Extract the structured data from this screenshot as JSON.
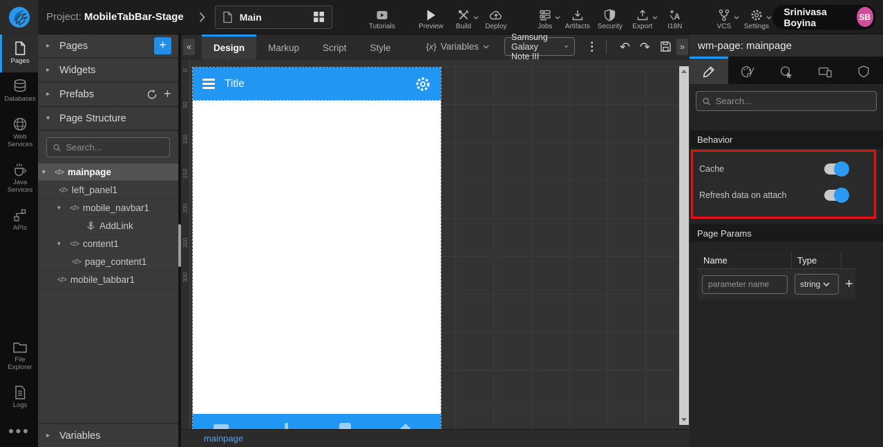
{
  "colors": {
    "accent": "#2196f3",
    "highlight": "#e90f0f",
    "avatar": "#cf4d9b"
  },
  "topbar": {
    "project_label": "Project:",
    "project_name": "MobileTabBar-Stage",
    "page_name": "Main",
    "tools": [
      {
        "label": "Tutorials"
      },
      {
        "label": "Preview"
      },
      {
        "label": "Build"
      },
      {
        "label": "Deploy"
      },
      {
        "label": "Jobs"
      },
      {
        "label": "Artifacts"
      },
      {
        "label": "Security"
      },
      {
        "label": "Export"
      },
      {
        "label": "I18N"
      },
      {
        "label": "VCS"
      },
      {
        "label": "Settings"
      }
    ],
    "user": {
      "name": "Srinivasa Boyina",
      "initials": "SB"
    }
  },
  "sidebar": {
    "items": [
      {
        "label": "Pages",
        "active": true
      },
      {
        "label": "Databases"
      },
      {
        "label": "Web Services"
      },
      {
        "label": "Java Services"
      },
      {
        "label": "APIs"
      }
    ],
    "bottom": [
      {
        "label": "File Explorer"
      },
      {
        "label": "Logs"
      }
    ]
  },
  "left_panel": {
    "sections": {
      "pages": "Pages",
      "widgets": "Widgets",
      "prefabs": "Prefabs",
      "page_structure": "Page Structure",
      "variables": "Variables"
    },
    "search_placeholder": "Search...",
    "tree": [
      {
        "label": "mainpage",
        "selected": true,
        "expanded": true
      },
      {
        "label": "left_panel1"
      },
      {
        "label": "mobile_navbar1",
        "expanded": true
      },
      {
        "label": "AddLink"
      },
      {
        "label": "content1",
        "expanded": true
      },
      {
        "label": "page_content1"
      },
      {
        "label": "mobile_tabbar1"
      }
    ]
  },
  "canvas": {
    "tabs": [
      {
        "label": "Design",
        "active": true
      },
      {
        "label": "Markup"
      },
      {
        "label": "Script"
      },
      {
        "label": "Style"
      }
    ],
    "variables_button": "Variables",
    "device": "Samsung Galaxy Note III",
    "ruler": [
      "0",
      "50",
      "100",
      "150",
      "200",
      "250",
      "300"
    ],
    "phone_title": "Title",
    "status_page": "mainpage"
  },
  "right_panel": {
    "title": "wm-page: mainpage",
    "search_placeholder": "Search...",
    "behavior": {
      "title": "Behavior",
      "rows": [
        {
          "label": "Cache",
          "on": true
        },
        {
          "label": "Refresh data on attach",
          "on": true
        }
      ]
    },
    "page_params": {
      "title": "Page Params",
      "col_name": "Name",
      "col_type": "Type",
      "param_placeholder": "parameter name",
      "type_value": "string"
    }
  }
}
